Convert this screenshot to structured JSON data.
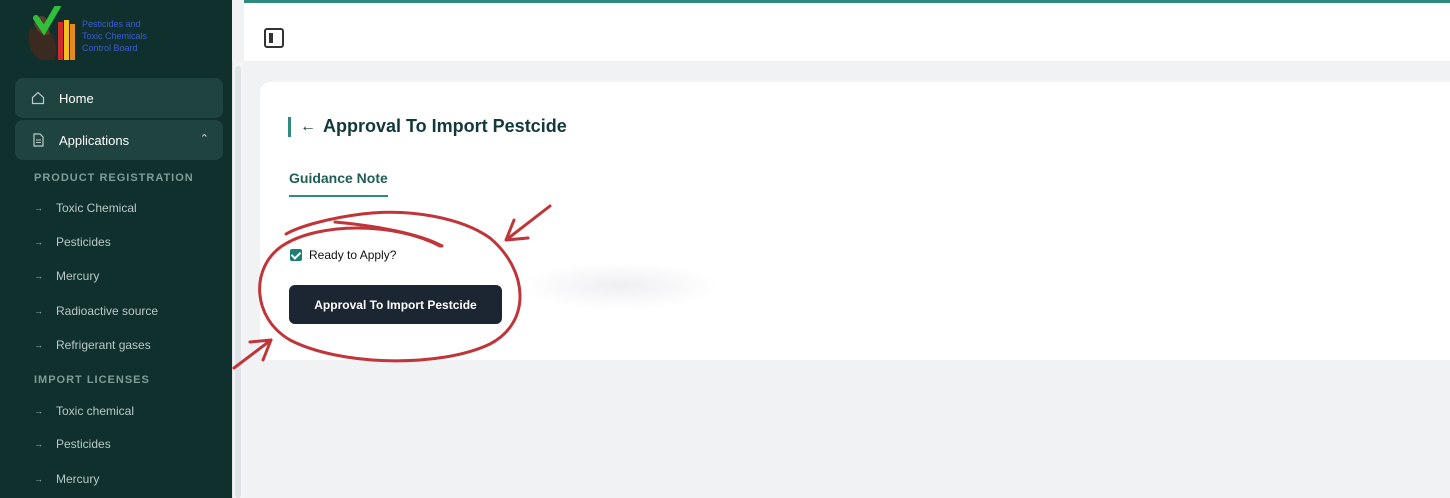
{
  "logo": {
    "lines": [
      "Pesticides and",
      "Toxic Chemicals",
      "Control Board"
    ]
  },
  "sidebar": {
    "nav": [
      {
        "label": "Home",
        "icon": "home-icon"
      },
      {
        "label": "Applications",
        "icon": "document-icon",
        "expanded": true
      }
    ],
    "sections": [
      {
        "title": "PRODUCT REGISTRATION",
        "items": [
          "Toxic Chemical",
          "Pesticides",
          "Mercury",
          "Radioactive source",
          "Refrigerant gases"
        ]
      },
      {
        "title": "IMPORT LICENSES",
        "items": [
          "Toxic chemical",
          "Pesticides",
          "Mercury"
        ]
      }
    ]
  },
  "page": {
    "title": "Approval To Import Pestcide",
    "back_icon": "back-arrow-icon",
    "tab": "Guidance Note",
    "checkbox_label": "Ready to Apply?",
    "checkbox_checked": true,
    "button_label": "Approval To Import Pestcide"
  },
  "colors": {
    "sidebar_bg": "#10302d",
    "accent": "#2d8a7d",
    "button_bg": "#1c2633",
    "annotation": "#c0353a"
  }
}
